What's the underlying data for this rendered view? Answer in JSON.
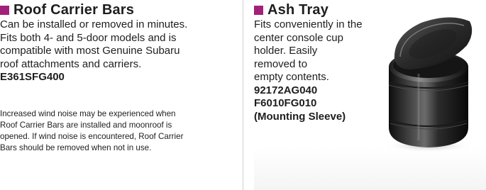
{
  "accent_color": "#a3207a",
  "left": {
    "title": "Roof Carrier Bars",
    "description_lines": [
      "Can be installed or removed in minutes.",
      "Fits both 4- and 5-door models and is",
      "compatible with most Genuine Subaru",
      "roof attachments and carriers."
    ],
    "part_numbers": [
      "E361SFG400"
    ],
    "note_lines": [
      "Increased wind noise may be experienced when",
      "Roof Carrier Bars are installed and moonroof is",
      "opened. If wind noise is encountered, Roof Carrier",
      "Bars should be removed when not in use."
    ]
  },
  "right": {
    "title": "Ash Tray",
    "description_lines": [
      "Fits conveniently in the",
      "center console cup",
      "holder. Easily",
      "removed to",
      "empty contents."
    ],
    "part_numbers": [
      "92172AG040",
      "F6010FG010",
      "(Mounting Sleeve)"
    ],
    "image_icon": "ash-tray-image"
  }
}
